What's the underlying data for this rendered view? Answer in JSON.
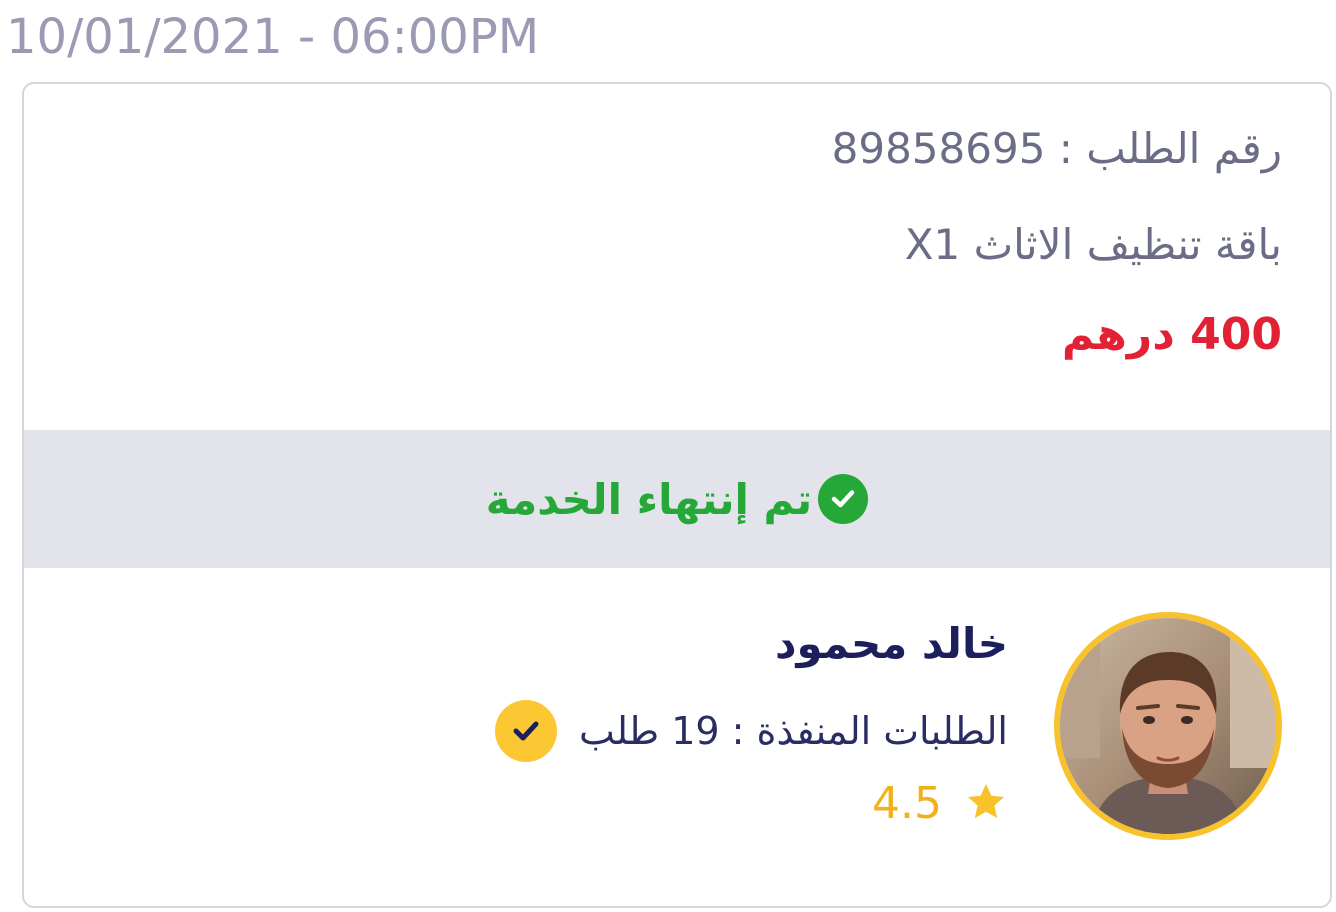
{
  "timestamp": "10/01/2021 - 06:00PM",
  "order": {
    "number_line": "رقم الطلب : 89858695",
    "package": "باقة تنظيف الاثاث X1",
    "price": "400 درهم"
  },
  "status": {
    "icon": "check-circle-icon",
    "text": "تم إنتهاء الخدمة",
    "color": "#25a837"
  },
  "worker": {
    "name": "خالد محمود",
    "completed_orders": "الطلبات المنفذة : 19 طلب",
    "rating": "4.5",
    "verified_icon": "verified-check-icon",
    "rating_icon": "star-icon"
  },
  "colors": {
    "price": "#e22134",
    "status_bg": "#e3e3ec",
    "accent": "#f8c22d",
    "name": "#1c1f5c"
  }
}
